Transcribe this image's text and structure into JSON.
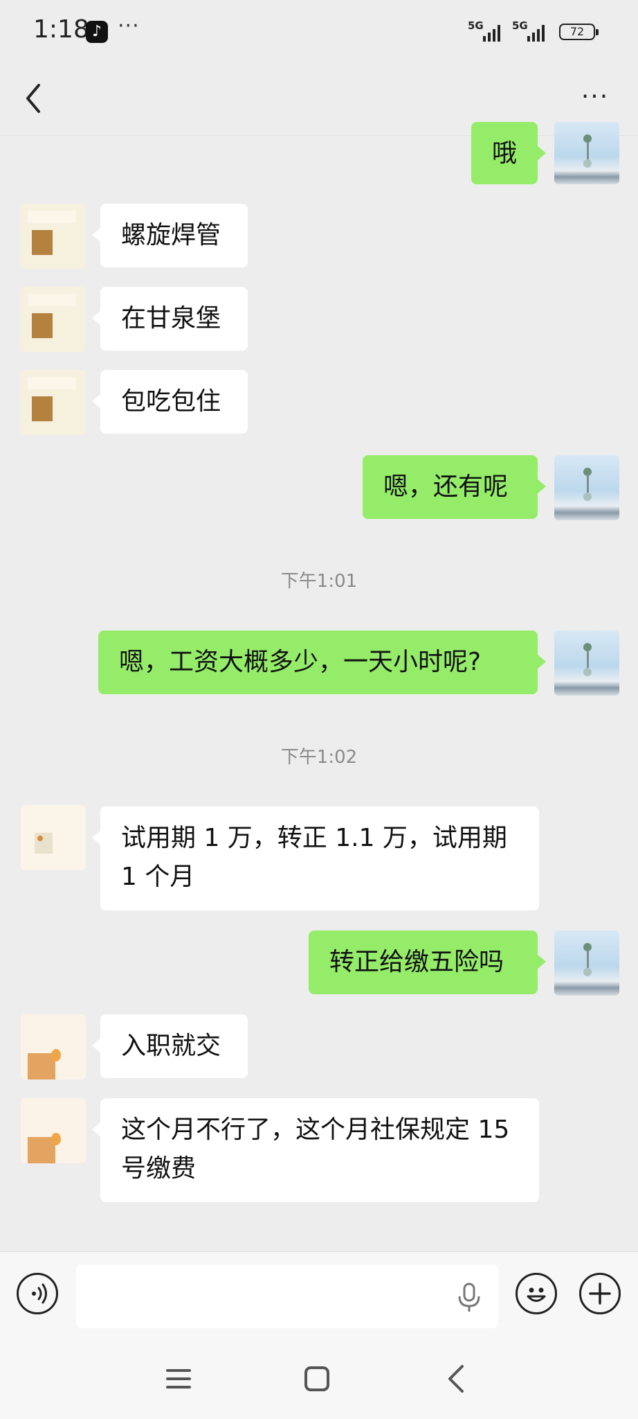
{
  "status_bar": {
    "time": "1:18",
    "more": "···",
    "signal1_label": "5G",
    "signal2_label": "5G",
    "battery": "72"
  },
  "navbar": {
    "more": "···"
  },
  "messages": {
    "m0": "哦",
    "m1": "螺旋焊管",
    "m2": "在甘泉堡",
    "m3": "包吃包住",
    "m4": "嗯，还有呢",
    "t1": "下午1:01",
    "m5": "嗯，工资大概多少，一天小时呢?",
    "t2": "下午1:02",
    "m6": "试用期 1 万，转正 1.1 万，试用期 1 个月",
    "m7": "转正给缴五险吗",
    "m8": "入职就交",
    "m9": "这个月不行了，这个月社保规定 15 号缴费"
  },
  "colors": {
    "self_bubble": "#95ec69",
    "other_bubble": "#ffffff",
    "background": "#ededed"
  },
  "icons": [
    "back-arrow-icon",
    "more-icon",
    "voice-icon",
    "mic-icon",
    "emoji-icon",
    "plus-icon",
    "menu-icon",
    "home-icon",
    "back-nav-icon"
  ]
}
